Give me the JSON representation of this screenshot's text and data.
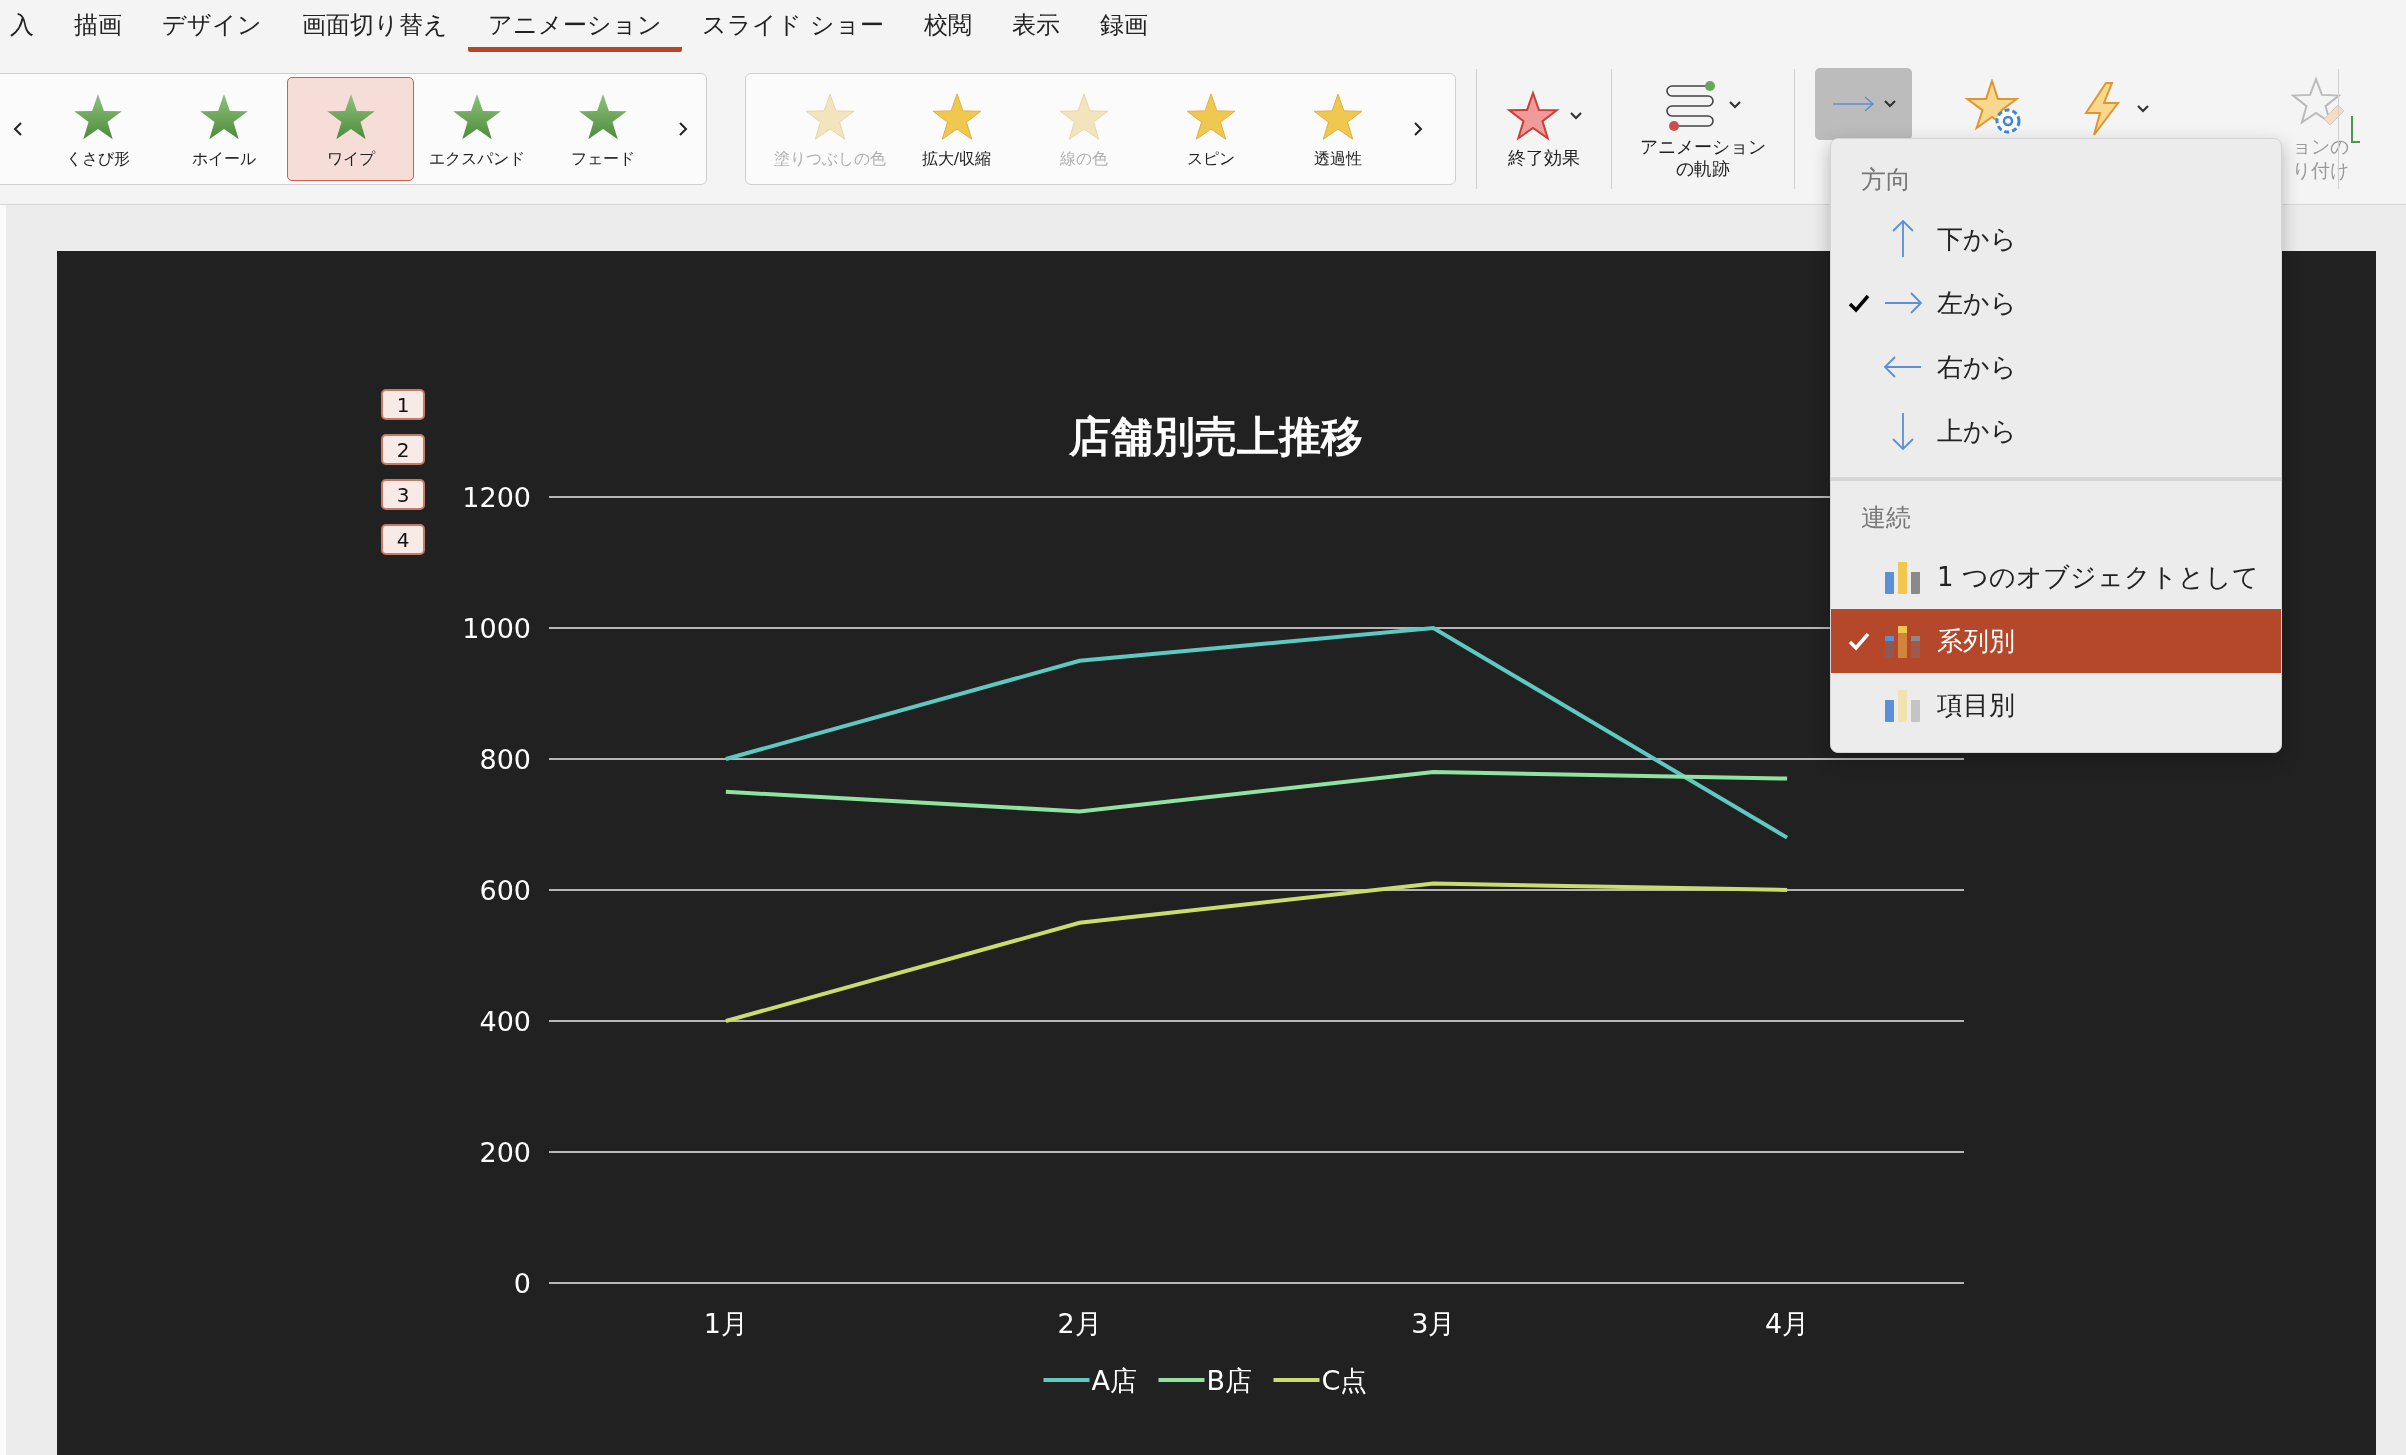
{
  "tabs": [
    {
      "label": "入",
      "selected": false
    },
    {
      "label": "描画",
      "selected": false
    },
    {
      "label": "デザイン",
      "selected": false
    },
    {
      "label": "画面切り替え",
      "selected": false
    },
    {
      "label": "アニメーション",
      "selected": true
    },
    {
      "label": "スライド ショー",
      "selected": false
    },
    {
      "label": "校閲",
      "selected": false
    },
    {
      "label": "表示",
      "selected": false
    },
    {
      "label": "録画",
      "selected": false
    }
  ],
  "entrance_gallery": [
    {
      "label": "くさび形",
      "selected": false
    },
    {
      "label": "ホイール",
      "selected": false
    },
    {
      "label": "ワイプ",
      "selected": true
    },
    {
      "label": "エクスパンド",
      "selected": false
    },
    {
      "label": "フェード",
      "selected": false
    }
  ],
  "emphasis_gallery": [
    {
      "label": "塗りつぶしの色",
      "disabled": true
    },
    {
      "label": "拡大/収縮",
      "disabled": false
    },
    {
      "label": "線の色",
      "disabled": true
    },
    {
      "label": "スピン",
      "disabled": false
    },
    {
      "label": "透過性",
      "disabled": false
    }
  ],
  "exit_button": {
    "label": "終了効果"
  },
  "path_button": {
    "label_lines": [
      "アニメーション",
      "の軌跡"
    ]
  },
  "effect_options": {
    "expanded": true
  },
  "painter_button": {
    "label_lines": [
      "ョンの",
      "り付け"
    ],
    "disabled": true
  },
  "slide": {
    "sequence_badges": [
      "1",
      "2",
      "3",
      "4"
    ],
    "chart_data": {
      "type": "line",
      "grid": true,
      "legend": true,
      "title": "店舗別売上推移",
      "categories": [
        "1月",
        "2月",
        "3月",
        "4月"
      ],
      "ylim": [
        0,
        1200
      ],
      "yticks": [
        0,
        200,
        400,
        600,
        800,
        1000,
        1200
      ],
      "series": [
        {
          "name": "A店",
          "color": "#5ec9c1",
          "values": [
            800,
            950,
            1000,
            680
          ]
        },
        {
          "name": "B店",
          "color": "#8ee3a0",
          "values": [
            750,
            720,
            780,
            770
          ]
        },
        {
          "name": "C点",
          "color": "#c9dc6c",
          "values": [
            400,
            550,
            610,
            600
          ]
        }
      ]
    }
  },
  "menu": {
    "sections": [
      {
        "heading": "方向",
        "items": [
          {
            "kind": "up",
            "label": "下から",
            "checked": false,
            "selected": false
          },
          {
            "kind": "right",
            "label": "左から",
            "checked": true,
            "selected": false
          },
          {
            "kind": "left",
            "label": "右から",
            "checked": false,
            "selected": false
          },
          {
            "kind": "down",
            "label": "上から",
            "checked": false,
            "selected": false
          }
        ]
      },
      {
        "heading": "連続",
        "items": [
          {
            "kind": "whole",
            "label": "1 つのオブジェクトとして",
            "checked": false,
            "selected": false
          },
          {
            "kind": "series",
            "label": "系列別",
            "checked": true,
            "selected": true
          },
          {
            "kind": "category",
            "label": "項目別",
            "checked": false,
            "selected": false
          }
        ]
      }
    ]
  }
}
